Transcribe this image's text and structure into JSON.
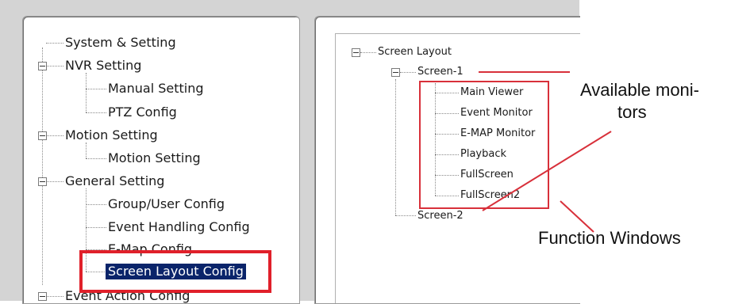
{
  "left_tree": {
    "items": [
      {
        "label": "System & Setting"
      },
      {
        "label": "NVR  Setting"
      },
      {
        "label": "Manual Setting"
      },
      {
        "label": "PTZ Config"
      },
      {
        "label": "Motion Setting"
      },
      {
        "label": "Motion Setting"
      },
      {
        "label": "General Setting"
      },
      {
        "label": "Group/User Config"
      },
      {
        "label": "Event Handling Config"
      },
      {
        "label": "E-Map Config"
      },
      {
        "label": "Screen Layout Config",
        "selected": true
      },
      {
        "label": "Event Action Config"
      }
    ]
  },
  "right_tree": {
    "root": "Screen Layout",
    "screen1": "Screen-1",
    "monitors": [
      "Main Viewer",
      "Event Monitor",
      "E-MAP Monitor",
      "Playback",
      "FullScreen",
      "FullScreen2"
    ],
    "screen2": "Screen-2"
  },
  "annotations": {
    "available_monitors_line1": "Available moni-",
    "available_monitors_line2": "tors",
    "function_windows": "Function Windows",
    "highlight_color": "#e0202a"
  }
}
